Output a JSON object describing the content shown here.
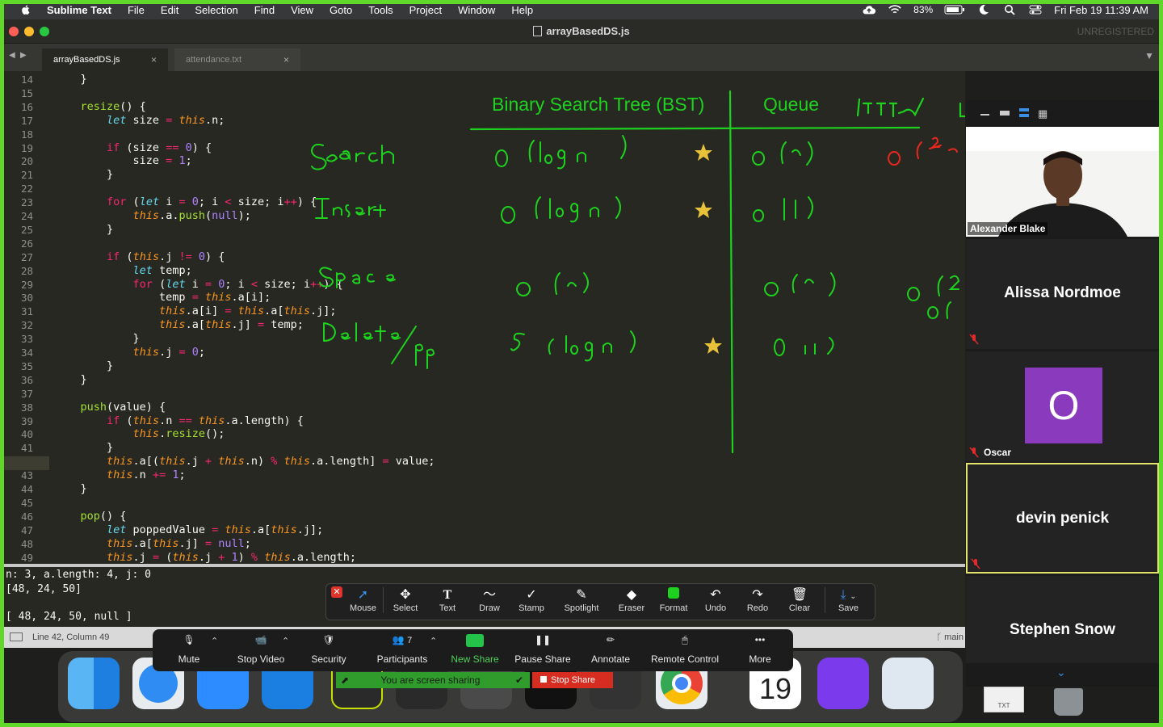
{
  "menubar": {
    "app_name": "Sublime Text",
    "menus": [
      "File",
      "Edit",
      "Selection",
      "Find",
      "View",
      "Goto",
      "Tools",
      "Project",
      "Window",
      "Help"
    ],
    "battery": "83%",
    "datetime": "Fri Feb 19  11:39 AM"
  },
  "window": {
    "title": "arrayBasedDS.js",
    "unregistered": "UNREGISTERED"
  },
  "tabs": [
    {
      "label": "arrayBasedDS.js",
      "active": true
    },
    {
      "label": "attendance.txt",
      "active": false
    }
  ],
  "editor": {
    "first_line": 14,
    "current_line": 42,
    "lines": [
      "    }",
      "",
      "    resize() {",
      "        let size = this.n;",
      "",
      "        if (size == 0) {",
      "            size = 1;",
      "        }",
      "",
      "        for (let i = 0; i < size; i++) {",
      "            this.a.push(null);",
      "        }",
      "",
      "        if (this.j != 0) {",
      "            let temp;",
      "            for (let i = 0; i < size; i++) {",
      "                temp = this.a[i];",
      "                this.a[i] = this.a[this.j];",
      "                this.a[this.j] = temp;",
      "            }",
      "            this.j = 0;",
      "        }",
      "    }",
      "",
      "    push(value) {",
      "        if (this.n == this.a.length) {",
      "            this.resize();",
      "        }",
      "        this.a[(this.j + this.n) % this.a.length] = value;",
      "        this.n += 1;",
      "    }",
      "",
      "    pop() {",
      "        let poppedValue = this.a[this.j];",
      "        this.a[this.j] = null;",
      "        this.j = (this.j + 1) % this.a.length;"
    ]
  },
  "whiteboard": {
    "headers": [
      "Binary Search Tree (BST)",
      "Queue"
    ],
    "rows": [
      "Search",
      "Insert",
      "Space",
      "Delete/pop"
    ],
    "bst_cells": [
      "O(log n)",
      "O(log n)",
      "O(n)",
      "O(log n)"
    ],
    "queue_cells": [
      "O(n)",
      "O(1)",
      "O(n)",
      "O(1)"
    ]
  },
  "console": {
    "lines": [
      "n: 3, a.length: 4, j: 0",
      "[48, 24, 50]",
      "",
      "[ 48, 24, 50, null ]"
    ]
  },
  "statusbar": {
    "position": "Line 42, Column 49",
    "branch": "main"
  },
  "annotate_toolbar": {
    "tools": [
      "Mouse",
      "Select",
      "Text",
      "Draw",
      "Stamp",
      "Spotlight",
      "Eraser",
      "Format",
      "Undo",
      "Redo",
      "Clear",
      "Save"
    ]
  },
  "zoom_controls": {
    "mute": "Mute",
    "stop_video": "Stop Video",
    "security": "Security",
    "participants": "Participants",
    "participants_count": "7",
    "new_share": "New Share",
    "pause_share": "Pause Share",
    "annotate": "Annotate",
    "remote_control": "Remote Control",
    "more": "More",
    "sharing_notice": "You are screen sharing",
    "stop_share": "Stop Share"
  },
  "participants": [
    {
      "name": "Alexander Blake",
      "video": true
    },
    {
      "name": "Alissa Nordmoe",
      "video": false
    },
    {
      "name": "Oscar",
      "avatar_letter": "O",
      "avatar_color": "#8a3bbd"
    },
    {
      "name": "devin penick",
      "video": false
    },
    {
      "name": "Stephen Snow",
      "video": false
    }
  ],
  "dock": {
    "calendar_day": "19",
    "file_label": "TXT"
  },
  "colors": {
    "accent_green": "#5fd82a",
    "marker_green": "#1fd11f",
    "marker_red": "#e8281e"
  }
}
